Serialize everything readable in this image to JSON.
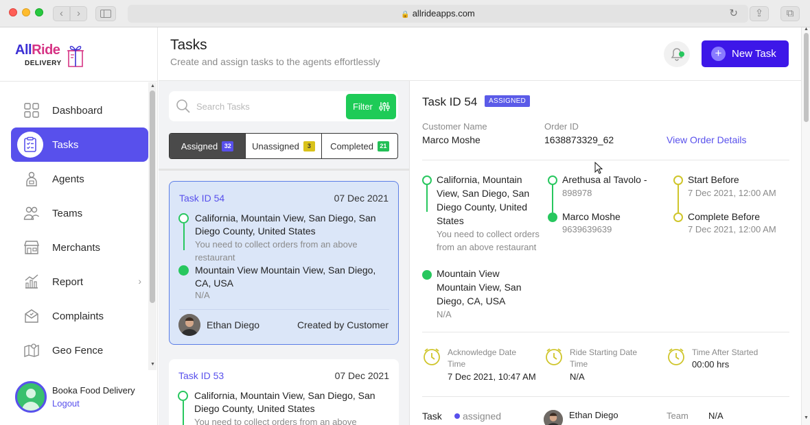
{
  "browser": {
    "url": "allrideapps.com"
  },
  "brand": {
    "name_part1": "All",
    "name_part2": "Ride",
    "tagline": "DELIVERY"
  },
  "sidebar": {
    "items": [
      {
        "label": "Dashboard",
        "icon": "dashboard-icon"
      },
      {
        "label": "Tasks",
        "icon": "tasks-icon",
        "active": true
      },
      {
        "label": "Agents",
        "icon": "agent-icon"
      },
      {
        "label": "Teams",
        "icon": "teams-icon"
      },
      {
        "label": "Merchants",
        "icon": "merchant-store-icon"
      },
      {
        "label": "Report",
        "icon": "report-chart-icon",
        "has_submenu": true
      },
      {
        "label": "Complaints",
        "icon": "complaints-icon"
      },
      {
        "label": "Geo Fence",
        "icon": "geo-fence-map-icon"
      }
    ],
    "user": {
      "name": "Booka Food Delivery",
      "logout_label": "Logout"
    }
  },
  "header": {
    "title": "Tasks",
    "subtitle": "Create and assign tasks to the agents effortlessly",
    "new_task_label": "New Task"
  },
  "task_list": {
    "search_placeholder": "Search Tasks",
    "filter_label": "Filter",
    "tabs": [
      {
        "label": "Assigned",
        "count": "32",
        "active": true
      },
      {
        "label": "Unassigned",
        "count": "3"
      },
      {
        "label": "Completed",
        "count": "21"
      }
    ],
    "cards": [
      {
        "id": "Task ID 54",
        "date": "07 Dec 2021",
        "pickup_address": "California, Mountain View, San Diego, San Diego County, United States",
        "pickup_note": "You need to collect orders from an above restaurant",
        "drop_address": "Mountain View Mountain View, San Diego, CA, USA",
        "drop_note": "N/A",
        "agent": "Ethan Diego",
        "created_by": "Created by Customer"
      },
      {
        "id": "Task ID 53",
        "date": "07 Dec 2021",
        "pickup_address": "California, Mountain View, San Diego, San Diego County, United States",
        "pickup_note": "You need to collect orders from an above"
      }
    ]
  },
  "detail": {
    "task_id": "Task ID 54",
    "status": "ASSIGNED",
    "customer_label": "Customer Name",
    "customer_name": "Marco Moshe",
    "order_label": "Order ID",
    "order_id": "1638873329_62",
    "view_order_label": "View Order Details",
    "pickup_address": "California, Mountain View, San Diego, San Diego County, United States",
    "pickup_note": "You need to collect orders from an above restaurant",
    "drop_address": "Mountain View Mountain View, San Diego, CA, USA",
    "drop_note": "N/A",
    "pickup_contact_name": "Arethusa al Tavolo -",
    "pickup_contact_phone": "898978",
    "drop_contact_name": "Marco Moshe",
    "drop_contact_phone": "9639639639",
    "start_before_label": "Start Before",
    "start_before_value": "7 Dec 2021, 12:00 AM",
    "complete_before_label": "Complete Before",
    "complete_before_value": "7 Dec 2021, 12:00 AM",
    "ack_label": "Acknowledge Date Time",
    "ack_value": "7 Dec 2021, 10:47 AM",
    "ride_start_label": "Ride Starting Date Time",
    "ride_start_value": "N/A",
    "time_after_label": "Time After Started",
    "time_after_value": "00:00 hrs",
    "task_label": "Task",
    "task_status": "assigned",
    "agent_name": "Ethan Diego",
    "team_label": "Team",
    "team_value": "N/A"
  },
  "colors": {
    "primary": "#5850ec",
    "new_task_button": "#3d17e8",
    "success_green": "#27c75e",
    "filter_green": "#1ecb57",
    "timeline_yellow": "#cfc52a",
    "selected_card_bg": "#dbe6f8"
  }
}
